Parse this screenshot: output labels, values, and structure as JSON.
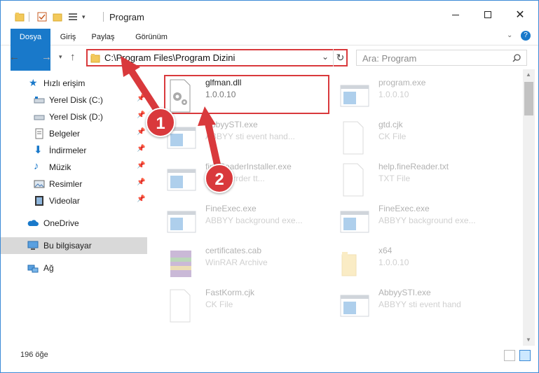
{
  "window": {
    "title": "Program",
    "min_icon": "minimize-icon",
    "max_icon": "maximize-icon",
    "close_icon": "close-icon"
  },
  "ribbon": {
    "tabs": [
      "Dosya",
      "Giriş",
      "Paylaş",
      "Görünüm"
    ]
  },
  "address": {
    "path": "C:\\Program Files\\Program Dizini",
    "search_placeholder": "Ara: Program"
  },
  "sidebar": {
    "items": [
      {
        "label": "Hızlı erişim",
        "icon": "star-icon"
      },
      {
        "label": "Yerel Disk (C:)",
        "icon": "drive-icon",
        "pinned": true
      },
      {
        "label": "Yerel Disk (D:)",
        "icon": "drive-icon",
        "pinned": true
      },
      {
        "label": "Belgeler",
        "icon": "document-icon",
        "pinned": true
      },
      {
        "label": "İndirmeler",
        "icon": "download-icon",
        "pinned": true
      },
      {
        "label": "Müzik",
        "icon": "music-icon",
        "pinned": true
      },
      {
        "label": "Resimler",
        "icon": "pictures-icon",
        "pinned": true
      },
      {
        "label": "Videolar",
        "icon": "video-icon",
        "pinned": true
      },
      {
        "label": "OneDrive",
        "icon": "cloud-icon"
      },
      {
        "label": "Bu bilgisayar",
        "icon": "computer-icon",
        "selected": true
      },
      {
        "label": "Ağ",
        "icon": "network-icon"
      }
    ]
  },
  "files": [
    {
      "name": "glfman.dll",
      "sub": "1.0.0.10",
      "icon": "dll-gear-icon",
      "highlighted": true
    },
    {
      "name": "program.exe",
      "sub": "1.0.0.10",
      "icon": "exe-icon"
    },
    {
      "name": "AbbyySTI.exe",
      "sub": "ABBYY sti event hand...",
      "icon": "exe-icon"
    },
    {
      "name": "gtd.cjk",
      "sub": "CK File",
      "icon": "blank-file-icon"
    },
    {
      "name": "fineReaderInstaller.exe",
      "sub": "...rcoserrder tt...",
      "icon": "exe-icon"
    },
    {
      "name": "help.fineReader.txt",
      "sub": "TXT File",
      "icon": "blank-file-icon"
    },
    {
      "name": "FineExec.exe",
      "sub": "ABBYY background exe...",
      "icon": "exe-icon"
    },
    {
      "name": "FineExec.exe",
      "sub": "ABBYY background exe...",
      "icon": "exe-icon"
    },
    {
      "name": "certificates.cab",
      "sub": "WinRAR Archive",
      "icon": "archive-icon"
    },
    {
      "name": "x64",
      "sub": "1.0.0.10",
      "icon": "folder-icon"
    },
    {
      "name": "FastKorm.cjk",
      "sub": "CK File",
      "icon": "blank-file-icon"
    },
    {
      "name": "AbbyySTI.exe",
      "sub": "ABBYY sti event hand",
      "icon": "exe-icon"
    }
  ],
  "status": {
    "count": "196 öğe"
  },
  "annotations": {
    "badge1": "1",
    "badge2": "2",
    "color": "#d9393c"
  }
}
